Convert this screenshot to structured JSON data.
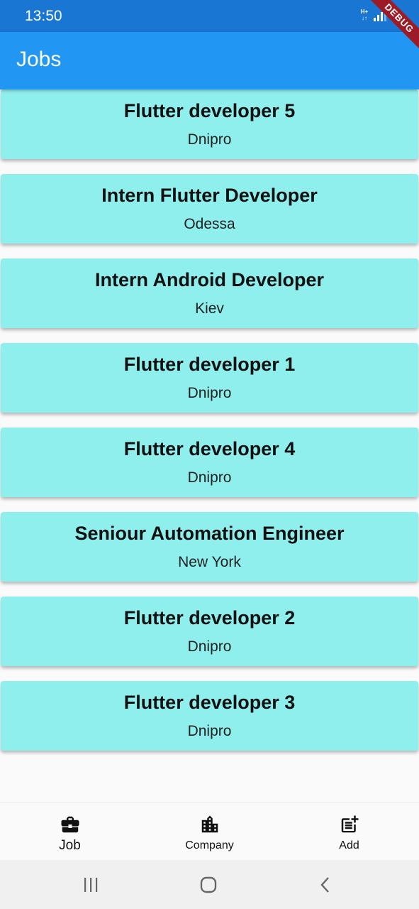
{
  "status_bar": {
    "time": "13:50",
    "network_label": "H+",
    "debug_banner": "DEBUG"
  },
  "app_bar": {
    "title": "Jobs"
  },
  "jobs": [
    {
      "title": "Flutter developer 5",
      "city": "Dnipro"
    },
    {
      "title": "Intern Flutter Developer",
      "city": "Odessa"
    },
    {
      "title": "Intern Android Developer",
      "city": "Kiev"
    },
    {
      "title": "Flutter developer 1",
      "city": "Dnipro"
    },
    {
      "title": "Flutter developer 4",
      "city": "Dnipro"
    },
    {
      "title": "Seniour Automation Engineer",
      "city": "New York"
    },
    {
      "title": "Flutter developer 2",
      "city": "Dnipro"
    },
    {
      "title": "Flutter developer 3",
      "city": "Dnipro"
    }
  ],
  "bottom_nav": [
    {
      "label": "Job",
      "icon": "briefcase-icon",
      "active": true
    },
    {
      "label": "Company",
      "icon": "building-icon",
      "active": false
    },
    {
      "label": "Add",
      "icon": "post-add-icon",
      "active": false
    }
  ],
  "colors": {
    "status_bar": "#1976d2",
    "app_bar": "#2196f3",
    "card": "#8eefed",
    "debug_banner": "#9c1b27"
  }
}
